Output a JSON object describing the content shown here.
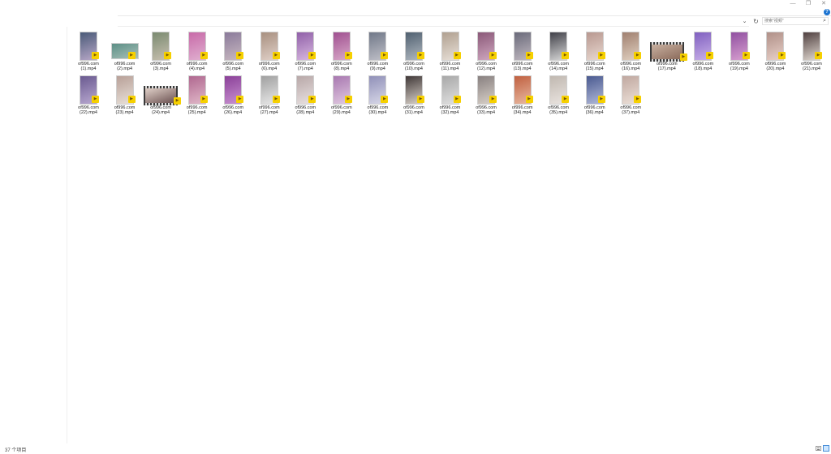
{
  "window": {
    "minimize": "—",
    "maximize": "❐",
    "close": "✕",
    "help": "?"
  },
  "address": {
    "chevron": "⌄",
    "refresh": "↻",
    "search_placeholder": "搜索\"视频\"",
    "search_glyph": "⌕"
  },
  "status": {
    "item_count": "37 个项目"
  },
  "files": [
    {
      "line1": "of996.com",
      "line2": "(1).mp4",
      "orient": "portrait",
      "c1": "#4a5a78",
      "c2": "#b8a8c8"
    },
    {
      "line1": "of996.com",
      "line2": "(2).mp4",
      "orient": "landscape",
      "c1": "#5c8f86",
      "c2": "#a8c0b8"
    },
    {
      "line1": "of996.com",
      "line2": "(3).mp4",
      "orient": "portrait",
      "c1": "#7a8a70",
      "c2": "#c8c0b0"
    },
    {
      "line1": "of996.com",
      "line2": "(4).mp4",
      "orient": "portrait",
      "c1": "#c86aa8",
      "c2": "#e0b0d0"
    },
    {
      "line1": "of996.com",
      "line2": "(5).mp4",
      "orient": "portrait",
      "c1": "#8a7a9a",
      "c2": "#c8b8c0"
    },
    {
      "line1": "of996.com",
      "line2": "(6).mp4",
      "orient": "portrait",
      "c1": "#a89080",
      "c2": "#e0d0c8"
    },
    {
      "line1": "of996.com",
      "line2": "(7).mp4",
      "orient": "portrait",
      "c1": "#9060a8",
      "c2": "#d8b8e0"
    },
    {
      "line1": "of996.com",
      "line2": "(8).mp4",
      "orient": "portrait",
      "c1": "#a05090",
      "c2": "#d8a8c8"
    },
    {
      "line1": "of996.com",
      "line2": "(9).mp4",
      "orient": "portrait",
      "c1": "#707888",
      "c2": "#c0c0c8"
    },
    {
      "line1": "of996.com",
      "line2": "(10).mp4",
      "orient": "portrait",
      "c1": "#506070",
      "c2": "#b0b8c0"
    },
    {
      "line1": "of996.com",
      "line2": "(11).mp4",
      "orient": "portrait",
      "c1": "#b0a090",
      "c2": "#e8e0d8"
    },
    {
      "line1": "of996.com",
      "line2": "(12).mp4",
      "orient": "portrait",
      "c1": "#8a5878",
      "c2": "#d0a8c0"
    },
    {
      "line1": "of996.com",
      "line2": "(13).mp4",
      "orient": "portrait",
      "c1": "#6a6a7a",
      "c2": "#c0b8c0"
    },
    {
      "line1": "of996.com",
      "line2": "(14).mp4",
      "orient": "portrait",
      "c1": "#404048",
      "c2": "#d8d8d8"
    },
    {
      "line1": "of996.com",
      "line2": "(15).mp4",
      "orient": "portrait",
      "c1": "#b89890",
      "c2": "#e8d8d0"
    },
    {
      "line1": "of996.com",
      "line2": "(16).mp4",
      "orient": "portrait",
      "c1": "#a08070",
      "c2": "#e0d0c0"
    },
    {
      "line1": "of996.com",
      "line2": "(17).mp4",
      "orient": "reel",
      "c1": "#c8b0a0",
      "c2": "#8a6a5a"
    },
    {
      "line1": "of996.com",
      "line2": "(18).mp4",
      "orient": "portrait",
      "c1": "#8060c0",
      "c2": "#c8b0e8"
    },
    {
      "line1": "of996.com",
      "line2": "(19).mp4",
      "orient": "portrait",
      "c1": "#9050a0",
      "c2": "#d8a0d0"
    },
    {
      "line1": "of996.com",
      "line2": "(20).mp4",
      "orient": "portrait",
      "c1": "#b09088",
      "c2": "#e8d0c8"
    },
    {
      "line1": "of996.com",
      "line2": "(21).mp4",
      "orient": "portrait",
      "c1": "#504040",
      "c2": "#e0d8d0"
    },
    {
      "line1": "of996.com",
      "line2": "(22).mp4",
      "orient": "portrait",
      "c1": "#6a5a90",
      "c2": "#b8a8d0"
    },
    {
      "line1": "of996.com",
      "line2": "(23).mp4",
      "orient": "portrait",
      "c1": "#b8a098",
      "c2": "#e8e0d8"
    },
    {
      "line1": "of996.com",
      "line2": "(24).mp4",
      "orient": "reel",
      "c1": "#e0d0c8",
      "c2": "#6a5050"
    },
    {
      "line1": "of996.com",
      "line2": "(25).mp4",
      "orient": "portrait",
      "c1": "#b06890",
      "c2": "#e0b8c8"
    },
    {
      "line1": "of996.com",
      "line2": "(26).mp4",
      "orient": "portrait",
      "c1": "#8a4098",
      "c2": "#c890d0"
    },
    {
      "line1": "of996.com",
      "line2": "(27).mp4",
      "orient": "portrait",
      "c1": "#a0a0a0",
      "c2": "#e8e8e8"
    },
    {
      "line1": "of996.com",
      "line2": "(28).mp4",
      "orient": "portrait",
      "c1": "#b8a8a8",
      "c2": "#e8e0e0"
    },
    {
      "line1": "of996.com",
      "line2": "(29).mp4",
      "orient": "portrait",
      "c1": "#a878b0",
      "c2": "#e0c8e0"
    },
    {
      "line1": "of996.com",
      "line2": "(30).mp4",
      "orient": "portrait",
      "c1": "#9090b8",
      "c2": "#d8d8e8"
    },
    {
      "line1": "of996.com",
      "line2": "(31).mp4",
      "orient": "portrait",
      "c1": "#403838",
      "c2": "#d8d0c8"
    },
    {
      "line1": "of996.com",
      "line2": "(32).mp4",
      "orient": "portrait",
      "c1": "#a8a8a8",
      "c2": "#e0e0e0"
    },
    {
      "line1": "of996.com",
      "line2": "(33).mp4",
      "orient": "portrait",
      "c1": "#888080",
      "c2": "#d8d0c8"
    },
    {
      "line1": "of996.com",
      "line2": "(34).mp4",
      "orient": "portrait",
      "c1": "#c06040",
      "c2": "#e8b8a0"
    },
    {
      "line1": "of996.com",
      "line2": "(35).mp4",
      "orient": "portrait",
      "c1": "#c0b8b0",
      "c2": "#eae4e0"
    },
    {
      "line1": "of996.com",
      "line2": "(36).mp4",
      "orient": "portrait",
      "c1": "#4a5a90",
      "c2": "#b0b8d8"
    },
    {
      "line1": "of996.com",
      "line2": "(37).mp4",
      "orient": "portrait",
      "c1": "#c0a8a0",
      "c2": "#ece0d8"
    }
  ]
}
